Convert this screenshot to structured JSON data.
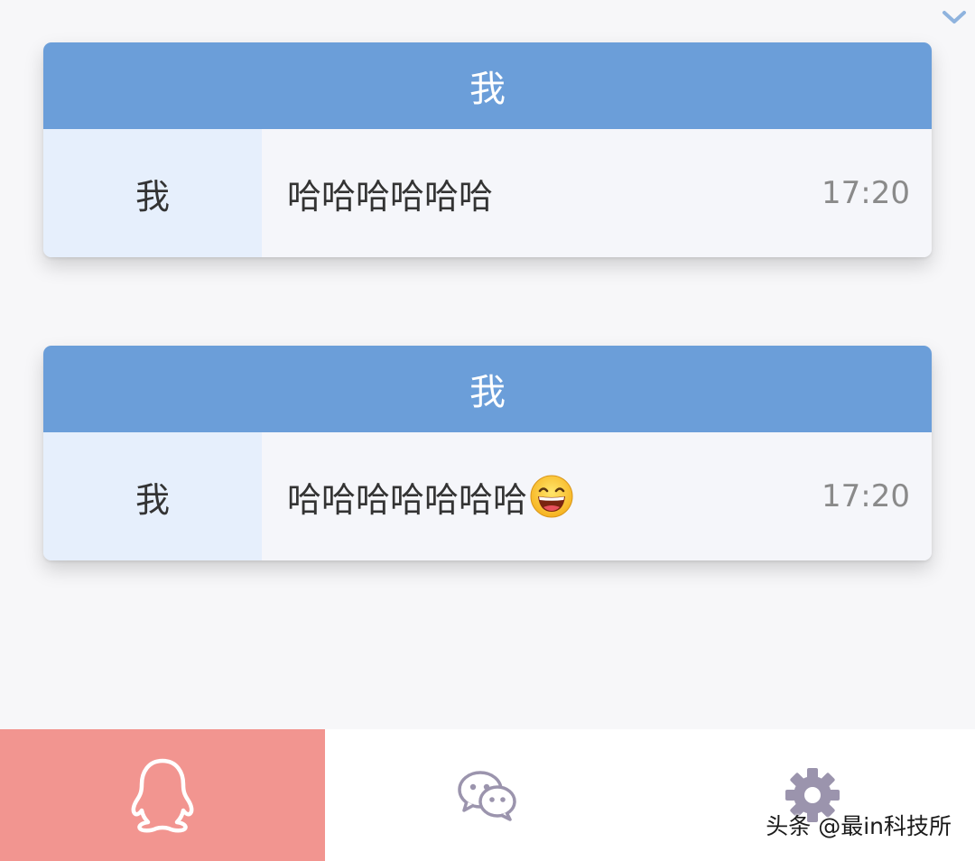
{
  "messages": [
    {
      "title": "我",
      "sender": "我",
      "text": "哈哈哈哈哈哈",
      "emoji": "",
      "time": "17:20"
    },
    {
      "title": "我",
      "sender": "我",
      "text": "哈哈哈哈哈哈哈",
      "emoji": "grinning-face",
      "time": "17:20"
    }
  ],
  "tabs": [
    {
      "icon": "qq-penguin-icon",
      "active": true
    },
    {
      "icon": "wechat-icon",
      "active": false
    },
    {
      "icon": "gear-icon",
      "active": false
    }
  ],
  "watermark": "头条 @最in科技所",
  "colors": {
    "header": "#6b9ed9",
    "sender_cell": "#e6effc",
    "active_tab": "#f29590",
    "tab_icon": "#9b94ad"
  }
}
